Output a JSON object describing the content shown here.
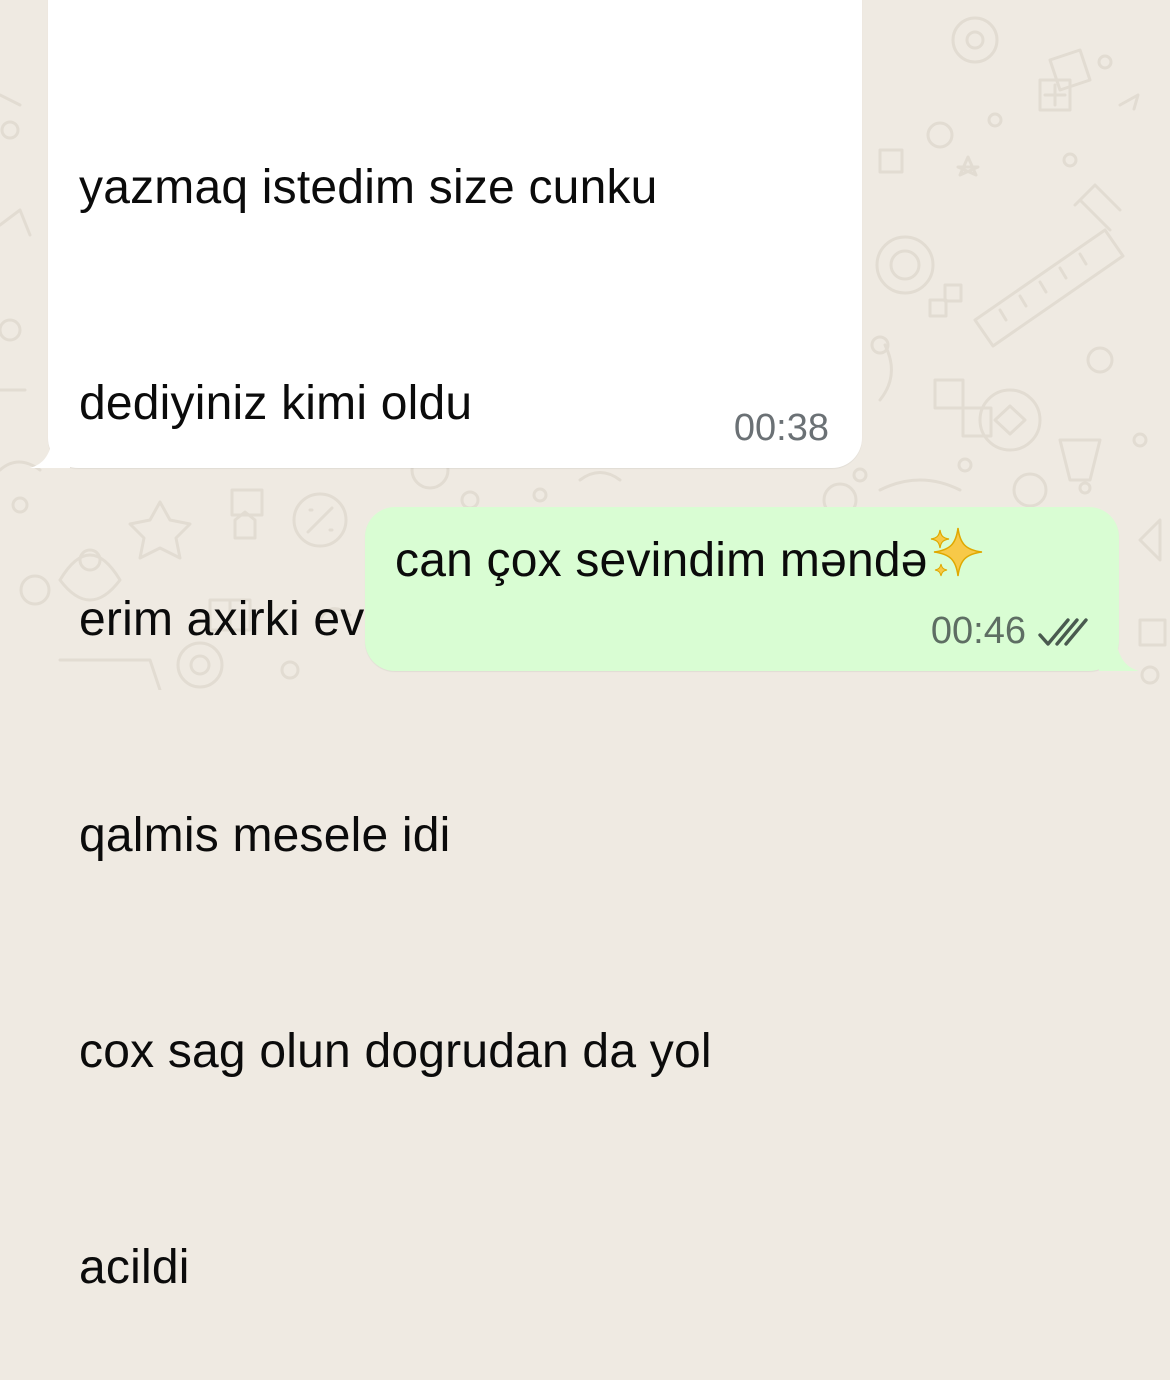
{
  "chat": {
    "messages": [
      {
        "direction": "incoming",
        "lines": [
          "yazmaq istedim size cunku",
          "dediyiniz kimi oldu",
          "erim axirki evi satdi coxdan",
          "qalmis mesele idi",
          "cox sag olun dogrudan da yol",
          "acildi"
        ],
        "time": "00:38"
      },
      {
        "direction": "outgoing",
        "text": "can çox sevindim məndə",
        "emoji": "sparkles-emoji",
        "time": "00:46",
        "status": "read",
        "status_icon": "double-check-icon"
      }
    ]
  },
  "colors": {
    "background": "#efeae2",
    "incoming_bubble": "#ffffff",
    "outgoing_bubble": "#d9fdd3",
    "read_ticks": "#4a5a4f"
  }
}
